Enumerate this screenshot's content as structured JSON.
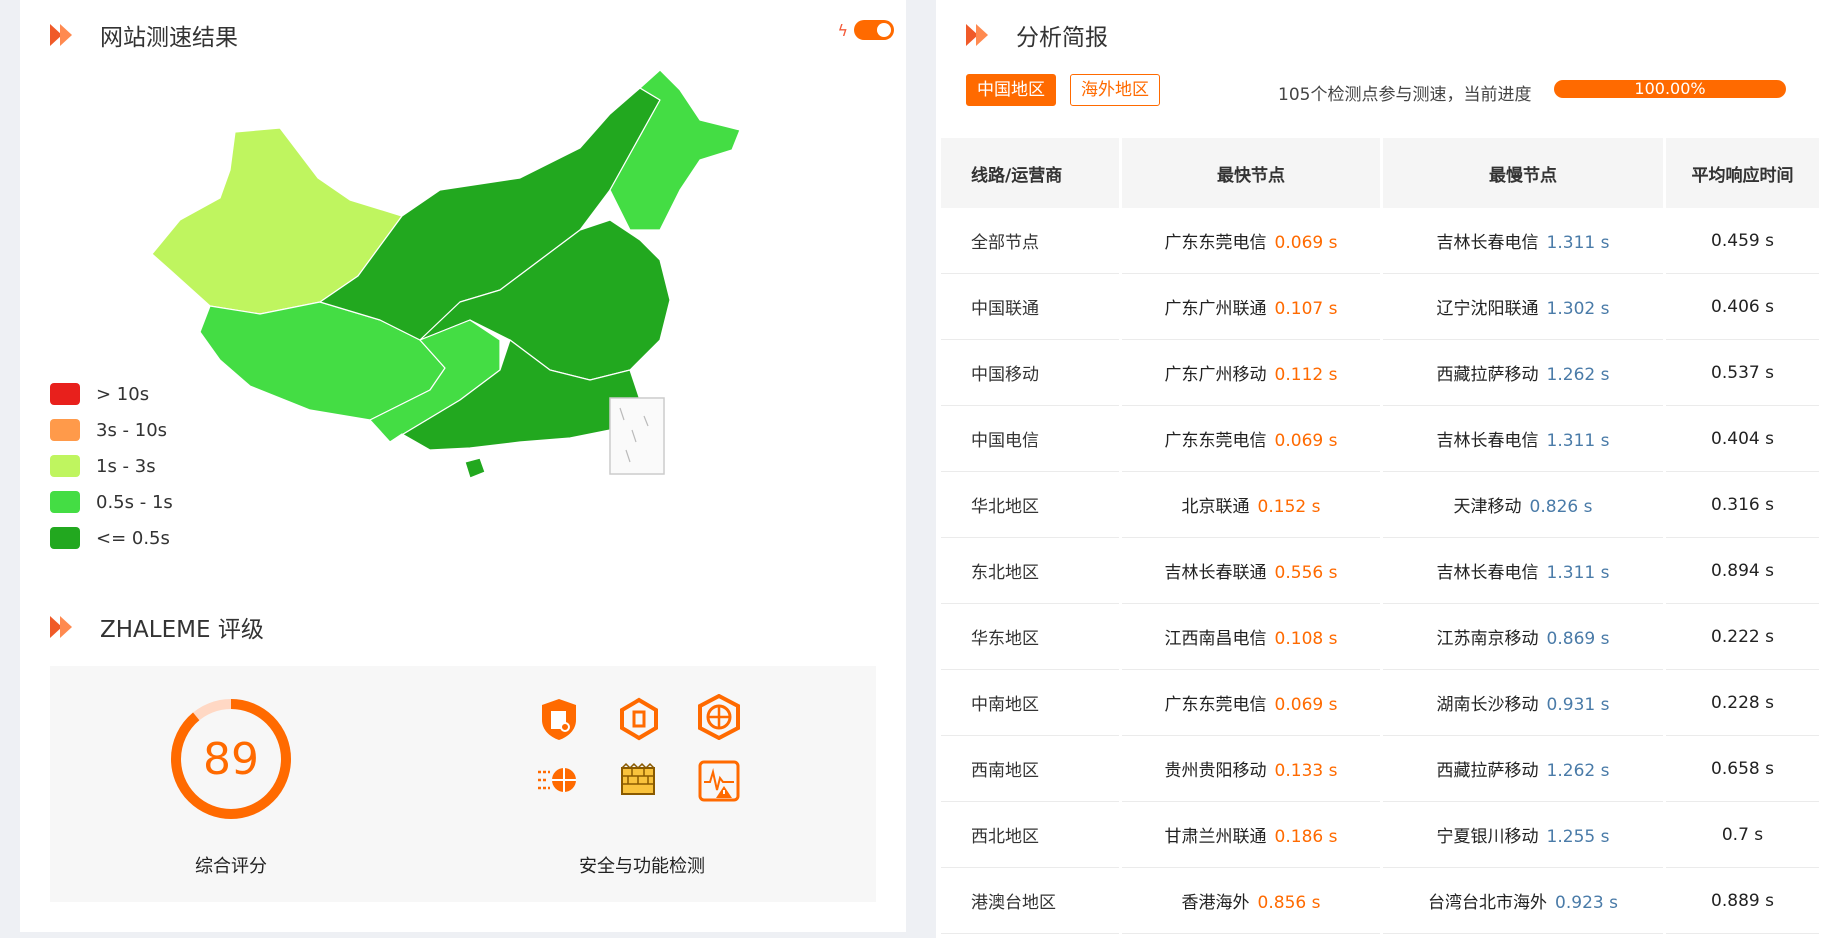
{
  "left": {
    "title": "网站测速结果",
    "legend": [
      {
        "label": "> 10s",
        "color": "#e8201c"
      },
      {
        "label": "3s - 10s",
        "color": "#ff9a4a"
      },
      {
        "label": "1s - 3s",
        "color": "#bff55f"
      },
      {
        "label": "0.5s - 1s",
        "color": "#44dd44"
      },
      {
        "label": "<= 0.5s",
        "color": "#22a81f"
      }
    ],
    "rating_title": "ZHALEME 评级",
    "score": "89",
    "score_fraction": 0.89,
    "score_label": "综合评分",
    "security_label": "安全与功能检测"
  },
  "right": {
    "title": "分析简报",
    "tabs": [
      "中国地区",
      "海外地区"
    ],
    "progress_text": "105个检测点参与测速，当前进度",
    "progress_value": "100.00%",
    "table": {
      "headers": [
        "线路/运营商",
        "最快节点",
        "最慢节点",
        "平均响应时间"
      ],
      "rows": [
        {
          "name": "全部节点",
          "fast_node": "广东东莞电信",
          "fast_time": "0.069 s",
          "slow_node": "吉林长春电信",
          "slow_time": "1.311 s",
          "avg": "0.459 s"
        },
        {
          "name": "中国联通",
          "fast_node": "广东广州联通",
          "fast_time": "0.107 s",
          "slow_node": "辽宁沈阳联通",
          "slow_time": "1.302 s",
          "avg": "0.406 s"
        },
        {
          "name": "中国移动",
          "fast_node": "广东广州移动",
          "fast_time": "0.112 s",
          "slow_node": "西藏拉萨移动",
          "slow_time": "1.262 s",
          "avg": "0.537 s"
        },
        {
          "name": "中国电信",
          "fast_node": "广东东莞电信",
          "fast_time": "0.069 s",
          "slow_node": "吉林长春电信",
          "slow_time": "1.311 s",
          "avg": "0.404 s"
        },
        {
          "name": "华北地区",
          "fast_node": "北京联通",
          "fast_time": "0.152 s",
          "slow_node": "天津移动",
          "slow_time": "0.826 s",
          "avg": "0.316 s"
        },
        {
          "name": "东北地区",
          "fast_node": "吉林长春联通",
          "fast_time": "0.556 s",
          "slow_node": "吉林长春电信",
          "slow_time": "1.311 s",
          "avg": "0.894 s"
        },
        {
          "name": "华东地区",
          "fast_node": "江西南昌电信",
          "fast_time": "0.108 s",
          "slow_node": "江苏南京移动",
          "slow_time": "0.869 s",
          "avg": "0.222 s"
        },
        {
          "name": "中南地区",
          "fast_node": "广东东莞电信",
          "fast_time": "0.069 s",
          "slow_node": "湖南长沙移动",
          "slow_time": "0.931 s",
          "avg": "0.228 s"
        },
        {
          "name": "西南地区",
          "fast_node": "贵州贵阳移动",
          "fast_time": "0.133 s",
          "slow_node": "西藏拉萨移动",
          "slow_time": "1.262 s",
          "avg": "0.658 s"
        },
        {
          "name": "西北地区",
          "fast_node": "甘肃兰州联通",
          "fast_time": "0.186 s",
          "slow_node": "宁夏银川移动",
          "slow_time": "1.255 s",
          "avg": "0.7 s"
        },
        {
          "name": "港澳台地区",
          "fast_node": "香港海外",
          "fast_time": "0.856 s",
          "slow_node": "台湾台北市海外",
          "slow_time": "0.923 s",
          "avg": "0.889 s"
        }
      ]
    }
  },
  "colors": {
    "accent": "#ff6a00",
    "title_arrow": "#f05a28",
    "slow_blue": "#4a7ba8"
  }
}
